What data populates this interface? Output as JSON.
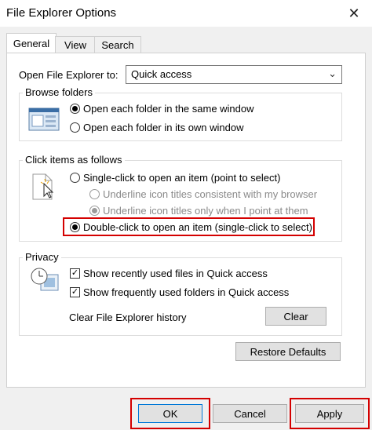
{
  "window": {
    "title": "File Explorer Options",
    "close_glyph": "✕"
  },
  "tabs": [
    {
      "label": "General"
    },
    {
      "label": "View"
    },
    {
      "label": "Search"
    }
  ],
  "open_to": {
    "label": "Open File Explorer to:",
    "value": "Quick access",
    "chevron": "⌄"
  },
  "browse": {
    "legend": "Browse folders",
    "options": [
      {
        "label": "Open each folder in the same window",
        "selected": true
      },
      {
        "label": "Open each folder in its own window",
        "selected": false
      }
    ]
  },
  "click": {
    "legend": "Click items as follows",
    "single": "Single-click to open an item (point to select)",
    "sub1": "Underline icon titles consistent with my browser",
    "sub2": "Underline icon titles only when I point at them",
    "double": "Double-click to open an item (single-click to select)"
  },
  "privacy": {
    "legend": "Privacy",
    "recent_files": "Show recently used files in Quick access",
    "frequent_folders": "Show frequently used folders in Quick access",
    "clear_label": "Clear File Explorer history",
    "clear_button": "Clear"
  },
  "restore_button": "Restore Defaults",
  "footer": {
    "ok": "OK",
    "cancel": "Cancel",
    "apply": "Apply"
  },
  "colors": {
    "highlight": "#d40000",
    "ok_border": "#0078d7"
  }
}
